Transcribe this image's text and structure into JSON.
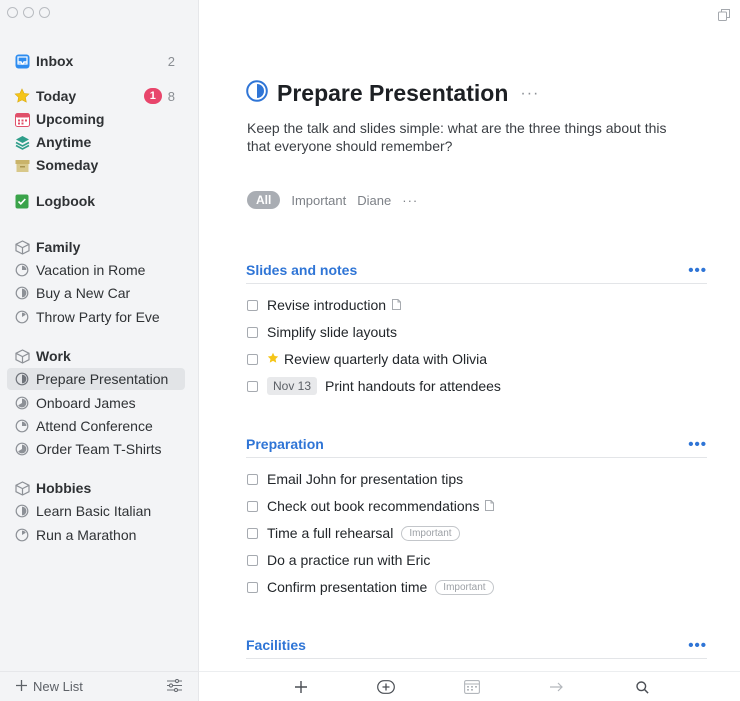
{
  "sidebar": {
    "inbox": {
      "label": "Inbox",
      "count": "2"
    },
    "today": {
      "label": "Today",
      "badge": "1",
      "count": "8"
    },
    "upcoming": {
      "label": "Upcoming"
    },
    "anytime": {
      "label": "Anytime"
    },
    "someday": {
      "label": "Someday"
    },
    "logbook": {
      "label": "Logbook"
    },
    "areas": [
      {
        "label": "Family",
        "projects": [
          "Vacation in Rome",
          "Buy a New Car",
          "Throw Party for Eve"
        ]
      },
      {
        "label": "Work",
        "projects": [
          "Prepare Presentation",
          "Onboard James",
          "Attend Conference",
          "Order Team T-Shirts"
        ]
      },
      {
        "label": "Hobbies",
        "projects": [
          "Learn Basic Italian",
          "Run a Marathon"
        ]
      }
    ],
    "footer": {
      "new_list": "New List"
    }
  },
  "main": {
    "title": "Prepare Presentation",
    "more": "···",
    "notes": "Keep the talk and slides simple: what are the three things about this that everyone should remember?",
    "tags": [
      "All",
      "Important",
      "Diane"
    ],
    "tags_more": "···",
    "headings": [
      {
        "label": "Slides and notes",
        "dots": "•••"
      },
      {
        "label": "Preparation",
        "dots": "•••"
      },
      {
        "label": "Facilities",
        "dots": "•••"
      }
    ],
    "todos_slides": [
      {
        "text": "Revise introduction"
      },
      {
        "text": "Simplify slide layouts"
      },
      {
        "text": "Review quarterly data with Olivia"
      },
      {
        "text": "Print handouts for attendees",
        "date": "Nov 13"
      }
    ],
    "todos_prep": [
      {
        "text": "Email John for presentation tips"
      },
      {
        "text": "Check out book recommendations"
      },
      {
        "text": "Time a full rehearsal",
        "tag": "Important"
      },
      {
        "text": "Do a practice run with Eric"
      },
      {
        "text": "Confirm presentation time",
        "tag": "Important"
      }
    ]
  },
  "icons": {
    "inbox": "inbox-icon",
    "today": "star-icon",
    "upcoming": "calendar-icon",
    "anytime": "layers-icon",
    "someday": "archive-box-icon",
    "logbook": "logbook-icon",
    "area": "cube-icon",
    "project": "progress-pie-icon"
  },
  "colors": {
    "accent": "#2f75d6",
    "badge": "#e8456b",
    "star": "#f5c518"
  }
}
